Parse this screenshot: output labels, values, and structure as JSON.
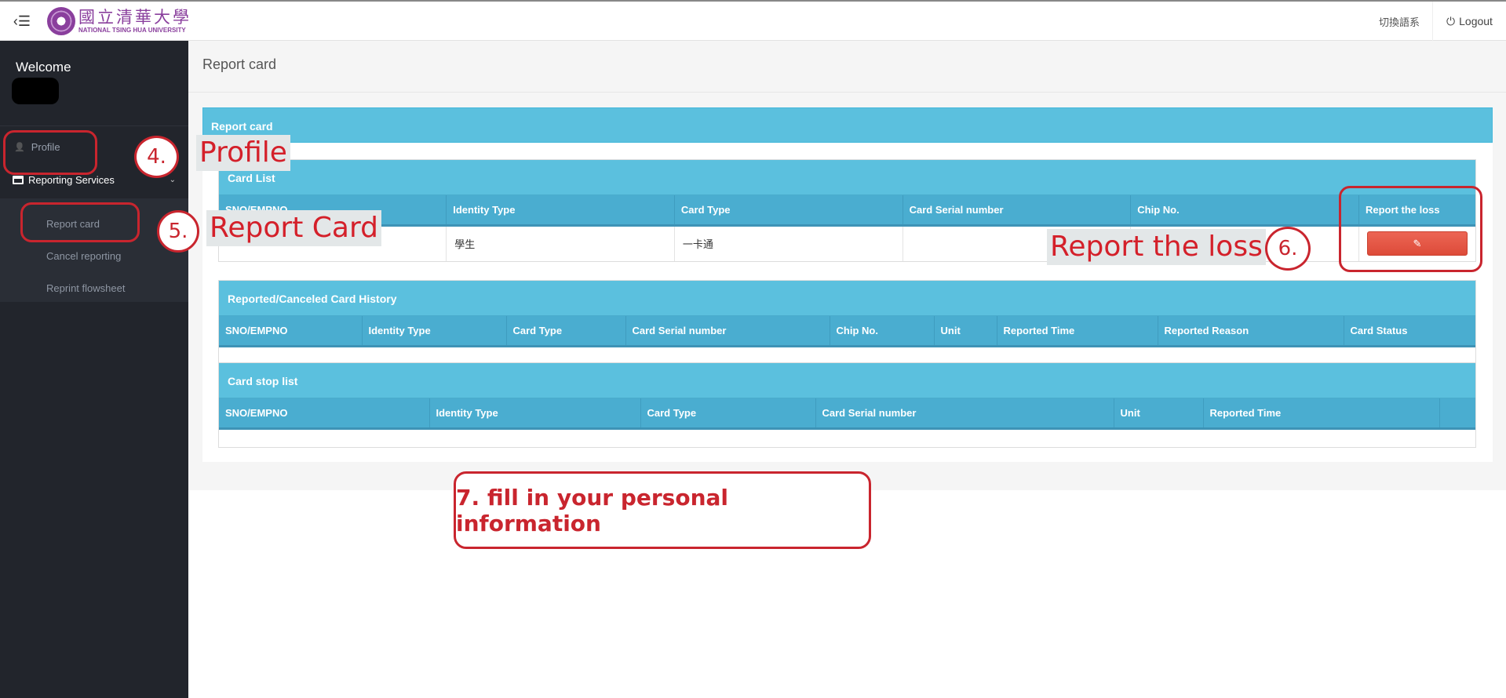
{
  "header": {
    "toggle_icon": "‹☰",
    "logo_cn": "國立清華大學",
    "logo_en": "NATIONAL TSING HUA UNIVERSITY",
    "language_switch": "切換語系",
    "logout_label": "Logout",
    "logout_icon": "⏻"
  },
  "sidebar": {
    "welcome": "Welcome",
    "profile_label": "Profile",
    "profile_icon": "👤",
    "services_label": "Reporting Services",
    "services_icon": "💳",
    "services_chevron": "⌄",
    "sub_items": [
      {
        "label": "Report card"
      },
      {
        "label": "Cancel reporting"
      },
      {
        "label": "Reprint flowsheet"
      }
    ]
  },
  "main": {
    "page_title": "Report card",
    "panel_title": "Report card",
    "card_list": {
      "title": "Card List",
      "columns": [
        "SNO/EMPNO",
        "Identity Type",
        "Card Type",
        "Card Serial number",
        "Chip No.",
        "Report the loss"
      ],
      "rows": [
        {
          "sno": "",
          "identity_type": "學生",
          "card_type": "一卡通",
          "serial": "",
          "chip": "",
          "action_icon": "✎"
        }
      ]
    },
    "history": {
      "title": "Reported/Canceled Card History",
      "columns": [
        "SNO/EMPNO",
        "Identity Type",
        "Card Type",
        "Card Serial number",
        "Chip No.",
        "Unit",
        "Reported Time",
        "Reported Reason",
        "Card Status"
      ]
    },
    "stop_list": {
      "title": "Card stop list",
      "columns": [
        "SNO/EMPNO",
        "Identity Type",
        "Card Type",
        "Card Serial number",
        "Unit",
        "Reported Time",
        ""
      ]
    }
  },
  "annotations": {
    "step4_num": "4.",
    "step4_label": "Profile",
    "step5_num": "5.",
    "step5_label": "Report Card",
    "step6_num": "6.",
    "step6_label": "Report the loss",
    "step7_note": "7. fill in your personal information",
    "color": "#c9252e"
  },
  "colors": {
    "sidebar_bg": "#22252c",
    "panel_head": "#5bc0de",
    "table_head": "#4aadd0",
    "danger": "#dd4b39"
  }
}
